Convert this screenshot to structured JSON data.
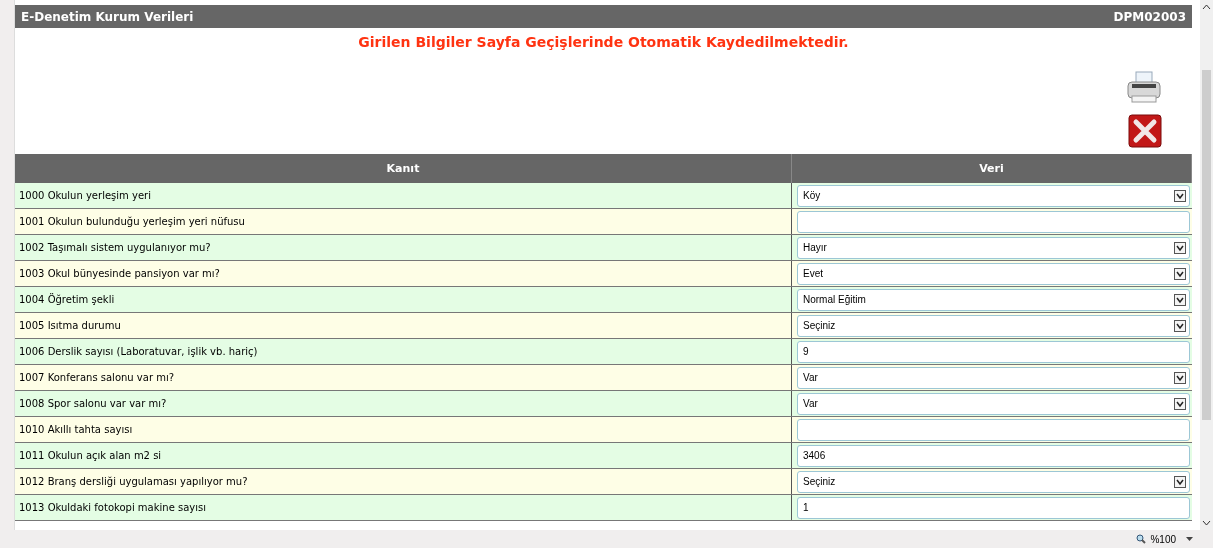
{
  "header": {
    "title": "E-Denetim Kurum Verileri",
    "code": "DPM02003"
  },
  "notice": "Girilen Bilgiler Sayfa Geçişlerinde Otomatik Kaydedilmektedir.",
  "table": {
    "columns": [
      "Kanıt",
      "Veri"
    ],
    "rows": [
      {
        "label": "1000 Okulun yerleşim yeri",
        "kind": "select",
        "value": "Köy"
      },
      {
        "label": "1001 Okulun bulunduğu yerleşim yeri nüfusu",
        "kind": "text"
      },
      {
        "label": "1002 Taşımalı sistem uygulanıyor mu?",
        "kind": "select",
        "value": "Hayır"
      },
      {
        "label": "1003 Okul bünyesinde pansiyon var mı?",
        "kind": "select",
        "value": "Evet"
      },
      {
        "label": "1004 Öğretim şekli",
        "kind": "select",
        "value": "Normal Eğitim"
      },
      {
        "label": "1005 Isıtma durumu",
        "kind": "select",
        "value": "Seçiniz"
      },
      {
        "label": "1006 Derslik sayısı (Laboratuvar, işlik vb. hariç)",
        "kind": "text",
        "value": "9"
      },
      {
        "label": "1007 Konferans salonu var mı?",
        "kind": "select",
        "value": "Var"
      },
      {
        "label": "1008 Spor salonu var var mı?",
        "kind": "select",
        "value": "Var"
      },
      {
        "label": "1010 Akıllı tahta sayısı",
        "kind": "text"
      },
      {
        "label": "1011 Okulun açık alan m2 si",
        "kind": "text",
        "value": "3406"
      },
      {
        "label": "1012 Branş dersliği uygulaması yapılıyor mu?",
        "kind": "select",
        "value": "Seçiniz"
      },
      {
        "label": "1013 Okuldaki fotokopi makine sayısı",
        "kind": "text",
        "value": "1"
      }
    ]
  },
  "status_bar": {
    "zoom": "%100"
  }
}
